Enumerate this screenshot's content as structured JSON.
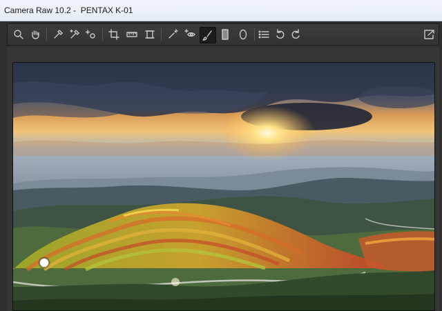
{
  "window": {
    "title": "Camera Raw 10.2 -  PENTAX K-01"
  },
  "toolbar": {
    "tools": [
      {
        "icon": "zoom-icon"
      },
      {
        "icon": "hand-icon"
      },
      {
        "icon": "white-balance-icon"
      },
      {
        "icon": "color-sampler-icon"
      },
      {
        "icon": "targeted-adjustment-icon"
      },
      {
        "icon": "crop-icon"
      },
      {
        "icon": "straighten-icon"
      },
      {
        "icon": "transform-icon"
      },
      {
        "icon": "spot-removal-icon"
      },
      {
        "icon": "red-eye-icon"
      },
      {
        "icon": "adjustment-brush-icon",
        "active": true
      },
      {
        "icon": "graduated-filter-icon"
      },
      {
        "icon": "radial-filter-icon"
      },
      {
        "icon": "preferences-icon"
      },
      {
        "icon": "rotate-ccw-icon"
      },
      {
        "icon": "rotate-cw-icon"
      },
      {
        "icon": "fullscreen-toggle-icon"
      }
    ]
  },
  "colors": {
    "toolbar_bg": "#363636",
    "icon": "#c9c9c9",
    "titlebar": "#e8eef6"
  }
}
